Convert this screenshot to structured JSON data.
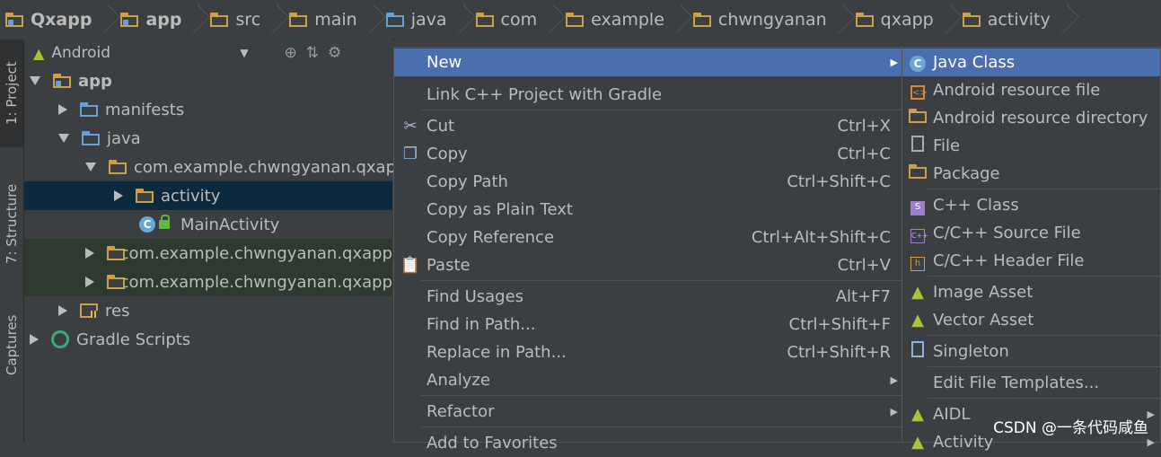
{
  "breadcrumb": [
    "Qxapp",
    "app",
    "src",
    "main",
    "java",
    "com",
    "example",
    "chwngyanan",
    "qxapp",
    "activity"
  ],
  "left_tabs": [
    "1: Project",
    "7: Structure",
    "Captures"
  ],
  "project_panel": {
    "view_mode": "Android"
  },
  "tree": {
    "app": "app",
    "manifests": "manifests",
    "java": "java",
    "pkg_main": "com.example.chwngyanan.qxapp",
    "activity": "activity",
    "main_activity": "MainActivity",
    "pkg_android_test": "com.example.chwngyanan.qxapp",
    "pkg_test": "com.example.chwngyanan.qxapp",
    "res": "res",
    "gradle_scripts": "Gradle Scripts"
  },
  "context_menu": {
    "new": "New",
    "link_cpp": "Link C++ Project with Gradle",
    "cut": "Cut",
    "cut_sc": "Ctrl+X",
    "copy": "Copy",
    "copy_sc": "Ctrl+C",
    "copy_path": "Copy Path",
    "copy_path_sc": "Ctrl+Shift+C",
    "copy_plain": "Copy as Plain Text",
    "copy_ref": "Copy Reference",
    "copy_ref_sc": "Ctrl+Alt+Shift+C",
    "paste": "Paste",
    "paste_sc": "Ctrl+V",
    "find_usages": "Find Usages",
    "find_usages_sc": "Alt+F7",
    "find_in_path": "Find in Path...",
    "find_in_path_sc": "Ctrl+Shift+F",
    "replace_in_path": "Replace in Path...",
    "replace_in_path_sc": "Ctrl+Shift+R",
    "analyze": "Analyze",
    "refactor": "Refactor",
    "add_favorites": "Add to Favorites"
  },
  "submenu": {
    "java_class": "Java Class",
    "android_resource_file": "Android resource file",
    "android_resource_directory": "Android resource directory",
    "file": "File",
    "package": "Package",
    "cpp_class": "C++ Class",
    "cpp_source": "C/C++ Source File",
    "cpp_header": "C/C++ Header File",
    "image_asset": "Image Asset",
    "vector_asset": "Vector Asset",
    "singleton": "Singleton",
    "edit_templates": "Edit File Templates...",
    "aidl": "AIDL",
    "activity": "Activity"
  },
  "watermark": "CSDN @一条代码咸鱼",
  "colors": {
    "highlight": "#4b6eaf",
    "selection": "#0d293e",
    "background": "#3c3f41",
    "folder": "#c9a04b",
    "android_green": "#a4c639"
  }
}
